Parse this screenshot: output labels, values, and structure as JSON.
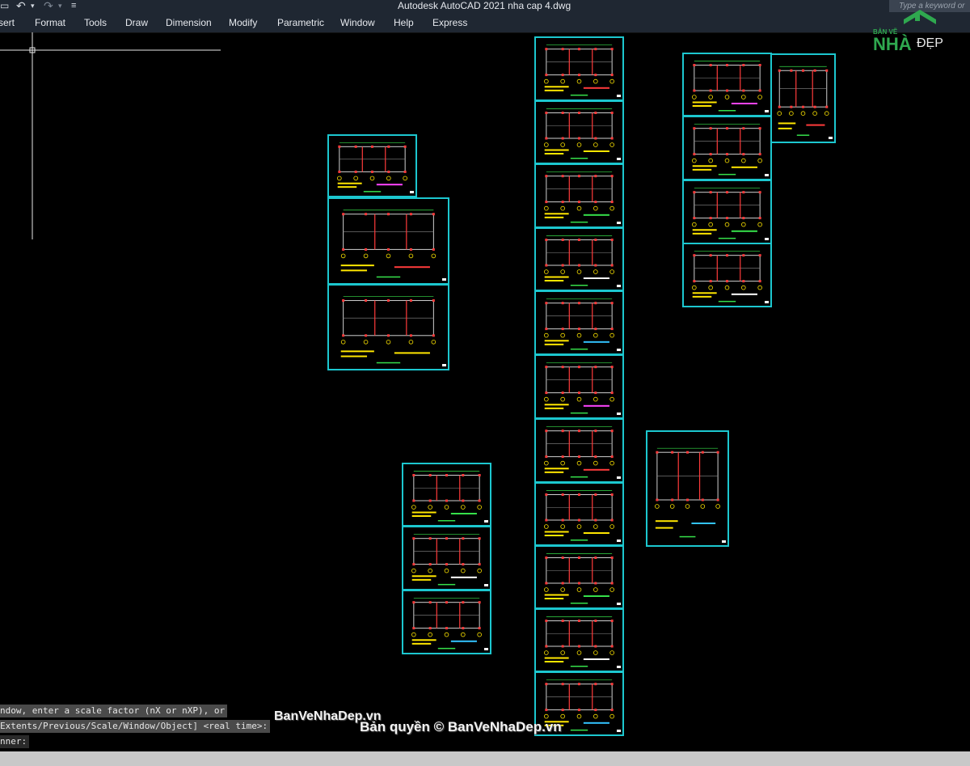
{
  "window": {
    "title": "Autodesk AutoCAD 2021    nha cap 4.dwg",
    "qat_glyphs": [
      "▭",
      "↶",
      "▾",
      "↷",
      "▾",
      "≡",
      "▾"
    ]
  },
  "search": {
    "placeholder": "Type a keyword or"
  },
  "menu": [
    {
      "id": "insert",
      "label": "Insert"
    },
    {
      "id": "format",
      "label": "Format"
    },
    {
      "id": "tools",
      "label": "Tools"
    },
    {
      "id": "draw",
      "label": "Draw"
    },
    {
      "id": "dimension",
      "label": "Dimension"
    },
    {
      "id": "modify",
      "label": "Modify"
    },
    {
      "id": "parametric",
      "label": "Parametric"
    },
    {
      "id": "window",
      "label": "Window"
    },
    {
      "id": "help",
      "label": "Help"
    },
    {
      "id": "express",
      "label": "Express"
    }
  ],
  "command": {
    "line1": "ndow, enter a scale factor (nX or nXP), or",
    "line2": "Extents/Previous/Scale/Window/Object] <real time>:",
    "line3": "nner:"
  },
  "watermark": {
    "main": "BanVeNhaDep.vn",
    "copyright": "Bản quyền © BanVeNhaDep.vn"
  },
  "logo": {
    "top": "BẢN VẼ",
    "nha": "NHÀ",
    "dep": "ĐẸP"
  },
  "colors": {
    "sheet_border": "#1cc7cf",
    "canvas": "#000000",
    "ui_dark": "#1f2732"
  }
}
